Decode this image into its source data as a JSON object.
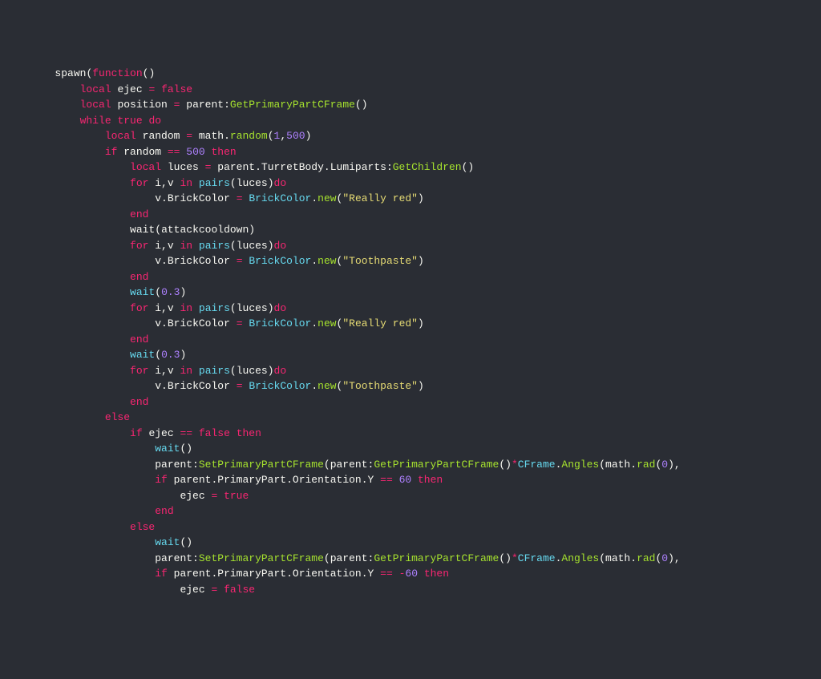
{
  "code": {
    "lines": [
      {
        "indent": 2,
        "tokens": [
          [
            "ident",
            "spawn"
          ],
          [
            "punc",
            "("
          ],
          [
            "kw-red",
            "function"
          ],
          [
            "punc",
            "()"
          ]
        ]
      },
      {
        "indent": 3,
        "tokens": [
          [
            "kw-red",
            "local"
          ],
          [
            "var",
            " ejec "
          ],
          [
            "op",
            "="
          ],
          [
            "punc",
            " "
          ],
          [
            "bool",
            "false"
          ]
        ]
      },
      {
        "indent": 3,
        "tokens": [
          [
            "kw-red",
            "local"
          ],
          [
            "var",
            " position "
          ],
          [
            "op",
            "="
          ],
          [
            "var",
            " parent"
          ],
          [
            "punc",
            ":"
          ],
          [
            "method",
            "GetPrimaryPartCFrame"
          ],
          [
            "punc",
            "()"
          ]
        ]
      },
      {
        "indent": 3,
        "tokens": [
          [
            "kw-red",
            "while"
          ],
          [
            "punc",
            " "
          ],
          [
            "bool",
            "true"
          ],
          [
            "punc",
            " "
          ],
          [
            "kw-red",
            "do"
          ]
        ]
      },
      {
        "indent": 4,
        "tokens": [
          [
            "kw-red",
            "local"
          ],
          [
            "var",
            " random "
          ],
          [
            "op",
            "="
          ],
          [
            "var",
            " math"
          ],
          [
            "punc",
            "."
          ],
          [
            "method",
            "random"
          ],
          [
            "punc",
            "("
          ],
          [
            "num",
            "1"
          ],
          [
            "punc",
            ","
          ],
          [
            "num",
            "500"
          ],
          [
            "punc",
            ")"
          ]
        ]
      },
      {
        "indent": 4,
        "tokens": [
          [
            "kw-red",
            "if"
          ],
          [
            "var",
            " random "
          ],
          [
            "op",
            "=="
          ],
          [
            "punc",
            " "
          ],
          [
            "num",
            "500"
          ],
          [
            "punc",
            " "
          ],
          [
            "kw-red",
            "then"
          ]
        ]
      },
      {
        "indent": 5,
        "tokens": [
          [
            "kw-red",
            "local"
          ],
          [
            "var",
            " luces "
          ],
          [
            "op",
            "="
          ],
          [
            "var",
            " parent"
          ],
          [
            "punc",
            "."
          ],
          [
            "var",
            "TurretBody"
          ],
          [
            "punc",
            "."
          ],
          [
            "var",
            "Lumiparts"
          ],
          [
            "punc",
            ":"
          ],
          [
            "method",
            "GetChildren"
          ],
          [
            "punc",
            "()"
          ]
        ]
      },
      {
        "indent": 5,
        "tokens": [
          [
            "kw-red",
            "for"
          ],
          [
            "var",
            " i"
          ],
          [
            "punc",
            ","
          ],
          [
            "var",
            "v "
          ],
          [
            "kw-red",
            "in"
          ],
          [
            "punc",
            " "
          ],
          [
            "fn",
            "pairs"
          ],
          [
            "punc",
            "("
          ],
          [
            "var",
            "luces"
          ],
          [
            "punc",
            ")"
          ],
          [
            "kw-red",
            "do"
          ]
        ]
      },
      {
        "indent": 6,
        "tokens": [
          [
            "var",
            "v"
          ],
          [
            "punc",
            "."
          ],
          [
            "var",
            "BrickColor "
          ],
          [
            "op",
            "="
          ],
          [
            "punc",
            " "
          ],
          [
            "type",
            "BrickColor"
          ],
          [
            "punc",
            "."
          ],
          [
            "method",
            "new"
          ],
          [
            "punc",
            "("
          ],
          [
            "str",
            "\"Really red\""
          ],
          [
            "punc",
            ")"
          ]
        ]
      },
      {
        "indent": 5,
        "tokens": [
          [
            "kw-red",
            "end"
          ]
        ]
      },
      {
        "indent": 5,
        "tokens": [
          [
            "ident",
            "wait"
          ],
          [
            "punc",
            "("
          ],
          [
            "var",
            "attackcooldown"
          ],
          [
            "punc",
            ")"
          ]
        ]
      },
      {
        "indent": 5,
        "tokens": [
          [
            "kw-red",
            "for"
          ],
          [
            "var",
            " i"
          ],
          [
            "punc",
            ","
          ],
          [
            "var",
            "v "
          ],
          [
            "kw-red",
            "in"
          ],
          [
            "punc",
            " "
          ],
          [
            "fn",
            "pairs"
          ],
          [
            "punc",
            "("
          ],
          [
            "var",
            "luces"
          ],
          [
            "punc",
            ")"
          ],
          [
            "kw-red",
            "do"
          ]
        ]
      },
      {
        "indent": 6,
        "tokens": [
          [
            "var",
            "v"
          ],
          [
            "punc",
            "."
          ],
          [
            "var",
            "BrickColor "
          ],
          [
            "op",
            "="
          ],
          [
            "punc",
            " "
          ],
          [
            "type",
            "BrickColor"
          ],
          [
            "punc",
            "."
          ],
          [
            "method",
            "new"
          ],
          [
            "punc",
            "("
          ],
          [
            "str",
            "\"Toothpaste\""
          ],
          [
            "punc",
            ")"
          ]
        ]
      },
      {
        "indent": 5,
        "tokens": [
          [
            "kw-red",
            "end"
          ]
        ]
      },
      {
        "indent": 5,
        "tokens": [
          [
            "fn",
            "wait"
          ],
          [
            "punc",
            "("
          ],
          [
            "num",
            "0.3"
          ],
          [
            "punc",
            ")"
          ]
        ]
      },
      {
        "indent": 5,
        "tokens": [
          [
            "kw-red",
            "for"
          ],
          [
            "var",
            " i"
          ],
          [
            "punc",
            ","
          ],
          [
            "var",
            "v "
          ],
          [
            "kw-red",
            "in"
          ],
          [
            "punc",
            " "
          ],
          [
            "fn",
            "pairs"
          ],
          [
            "punc",
            "("
          ],
          [
            "var",
            "luces"
          ],
          [
            "punc",
            ")"
          ],
          [
            "kw-red",
            "do"
          ]
        ]
      },
      {
        "indent": 6,
        "tokens": [
          [
            "var",
            "v"
          ],
          [
            "punc",
            "."
          ],
          [
            "var",
            "BrickColor "
          ],
          [
            "op",
            "="
          ],
          [
            "punc",
            " "
          ],
          [
            "type",
            "BrickColor"
          ],
          [
            "punc",
            "."
          ],
          [
            "method",
            "new"
          ],
          [
            "punc",
            "("
          ],
          [
            "str",
            "\"Really red\""
          ],
          [
            "punc",
            ")"
          ]
        ]
      },
      {
        "indent": 5,
        "tokens": [
          [
            "kw-red",
            "end"
          ]
        ]
      },
      {
        "indent": 5,
        "tokens": [
          [
            "fn",
            "wait"
          ],
          [
            "punc",
            "("
          ],
          [
            "num",
            "0.3"
          ],
          [
            "punc",
            ")"
          ]
        ]
      },
      {
        "indent": 5,
        "tokens": [
          [
            "kw-red",
            "for"
          ],
          [
            "var",
            " i"
          ],
          [
            "punc",
            ","
          ],
          [
            "var",
            "v "
          ],
          [
            "kw-red",
            "in"
          ],
          [
            "punc",
            " "
          ],
          [
            "fn",
            "pairs"
          ],
          [
            "punc",
            "("
          ],
          [
            "var",
            "luces"
          ],
          [
            "punc",
            ")"
          ],
          [
            "kw-red",
            "do"
          ]
        ]
      },
      {
        "indent": 6,
        "tokens": [
          [
            "var",
            "v"
          ],
          [
            "punc",
            "."
          ],
          [
            "var",
            "BrickColor "
          ],
          [
            "op",
            "="
          ],
          [
            "punc",
            " "
          ],
          [
            "type",
            "BrickColor"
          ],
          [
            "punc",
            "."
          ],
          [
            "method",
            "new"
          ],
          [
            "punc",
            "("
          ],
          [
            "str",
            "\"Toothpaste\""
          ],
          [
            "punc",
            ")"
          ]
        ]
      },
      {
        "indent": 5,
        "tokens": [
          [
            "kw-red",
            "end"
          ]
        ]
      },
      {
        "indent": 4,
        "tokens": [
          [
            "kw-red",
            "else"
          ]
        ]
      },
      {
        "indent": 5,
        "tokens": [
          [
            "kw-red",
            "if"
          ],
          [
            "var",
            " ejec "
          ],
          [
            "op",
            "=="
          ],
          [
            "punc",
            " "
          ],
          [
            "bool",
            "false"
          ],
          [
            "punc",
            " "
          ],
          [
            "kw-red",
            "then"
          ]
        ]
      },
      {
        "indent": 6,
        "tokens": [
          [
            "fn",
            "wait"
          ],
          [
            "punc",
            "()"
          ]
        ]
      },
      {
        "indent": 6,
        "tokens": [
          [
            "var",
            "parent"
          ],
          [
            "punc",
            ":"
          ],
          [
            "method",
            "SetPrimaryPartCFrame"
          ],
          [
            "punc",
            "("
          ],
          [
            "var",
            "parent"
          ],
          [
            "punc",
            ":"
          ],
          [
            "method",
            "GetPrimaryPartCFrame"
          ],
          [
            "punc",
            "()"
          ],
          [
            "op",
            "*"
          ],
          [
            "type",
            "CFrame"
          ],
          [
            "punc",
            "."
          ],
          [
            "method",
            "Angles"
          ],
          [
            "punc",
            "("
          ],
          [
            "var",
            "math"
          ],
          [
            "punc",
            "."
          ],
          [
            "method",
            "rad"
          ],
          [
            "punc",
            "("
          ],
          [
            "num",
            "0"
          ],
          [
            "punc",
            "),"
          ]
        ]
      },
      {
        "indent": 6,
        "tokens": [
          [
            "kw-red",
            "if"
          ],
          [
            "var",
            " parent"
          ],
          [
            "punc",
            "."
          ],
          [
            "var",
            "PrimaryPart"
          ],
          [
            "punc",
            "."
          ],
          [
            "var",
            "Orientation"
          ],
          [
            "punc",
            "."
          ],
          [
            "var",
            "Y "
          ],
          [
            "op",
            "=="
          ],
          [
            "punc",
            " "
          ],
          [
            "num",
            "60"
          ],
          [
            "punc",
            " "
          ],
          [
            "kw-red",
            "then"
          ]
        ]
      },
      {
        "indent": 7,
        "tokens": [
          [
            "var",
            "ejec "
          ],
          [
            "op",
            "="
          ],
          [
            "punc",
            " "
          ],
          [
            "bool",
            "true"
          ]
        ]
      },
      {
        "indent": 6,
        "tokens": [
          [
            "kw-red",
            "end"
          ]
        ]
      },
      {
        "indent": 5,
        "tokens": [
          [
            "kw-red",
            "else"
          ]
        ]
      },
      {
        "indent": 6,
        "tokens": [
          [
            "fn",
            "wait"
          ],
          [
            "punc",
            "()"
          ]
        ]
      },
      {
        "indent": 6,
        "tokens": [
          [
            "var",
            "parent"
          ],
          [
            "punc",
            ":"
          ],
          [
            "method",
            "SetPrimaryPartCFrame"
          ],
          [
            "punc",
            "("
          ],
          [
            "var",
            "parent"
          ],
          [
            "punc",
            ":"
          ],
          [
            "method",
            "GetPrimaryPartCFrame"
          ],
          [
            "punc",
            "()"
          ],
          [
            "op",
            "*"
          ],
          [
            "type",
            "CFrame"
          ],
          [
            "punc",
            "."
          ],
          [
            "method",
            "Angles"
          ],
          [
            "punc",
            "("
          ],
          [
            "var",
            "math"
          ],
          [
            "punc",
            "."
          ],
          [
            "method",
            "rad"
          ],
          [
            "punc",
            "("
          ],
          [
            "num",
            "0"
          ],
          [
            "punc",
            "),"
          ]
        ]
      },
      {
        "indent": 6,
        "tokens": [
          [
            "kw-red",
            "if"
          ],
          [
            "var",
            " parent"
          ],
          [
            "punc",
            "."
          ],
          [
            "var",
            "PrimaryPart"
          ],
          [
            "punc",
            "."
          ],
          [
            "var",
            "Orientation"
          ],
          [
            "punc",
            "."
          ],
          [
            "var",
            "Y "
          ],
          [
            "op",
            "=="
          ],
          [
            "punc",
            " "
          ],
          [
            "op",
            "-"
          ],
          [
            "num",
            "60"
          ],
          [
            "punc",
            " "
          ],
          [
            "kw-red",
            "then"
          ]
        ]
      },
      {
        "indent": 7,
        "tokens": [
          [
            "var",
            "ejec "
          ],
          [
            "op",
            "="
          ],
          [
            "punc",
            " "
          ],
          [
            "bool",
            "false"
          ]
        ]
      }
    ],
    "indent_unit": "    "
  }
}
